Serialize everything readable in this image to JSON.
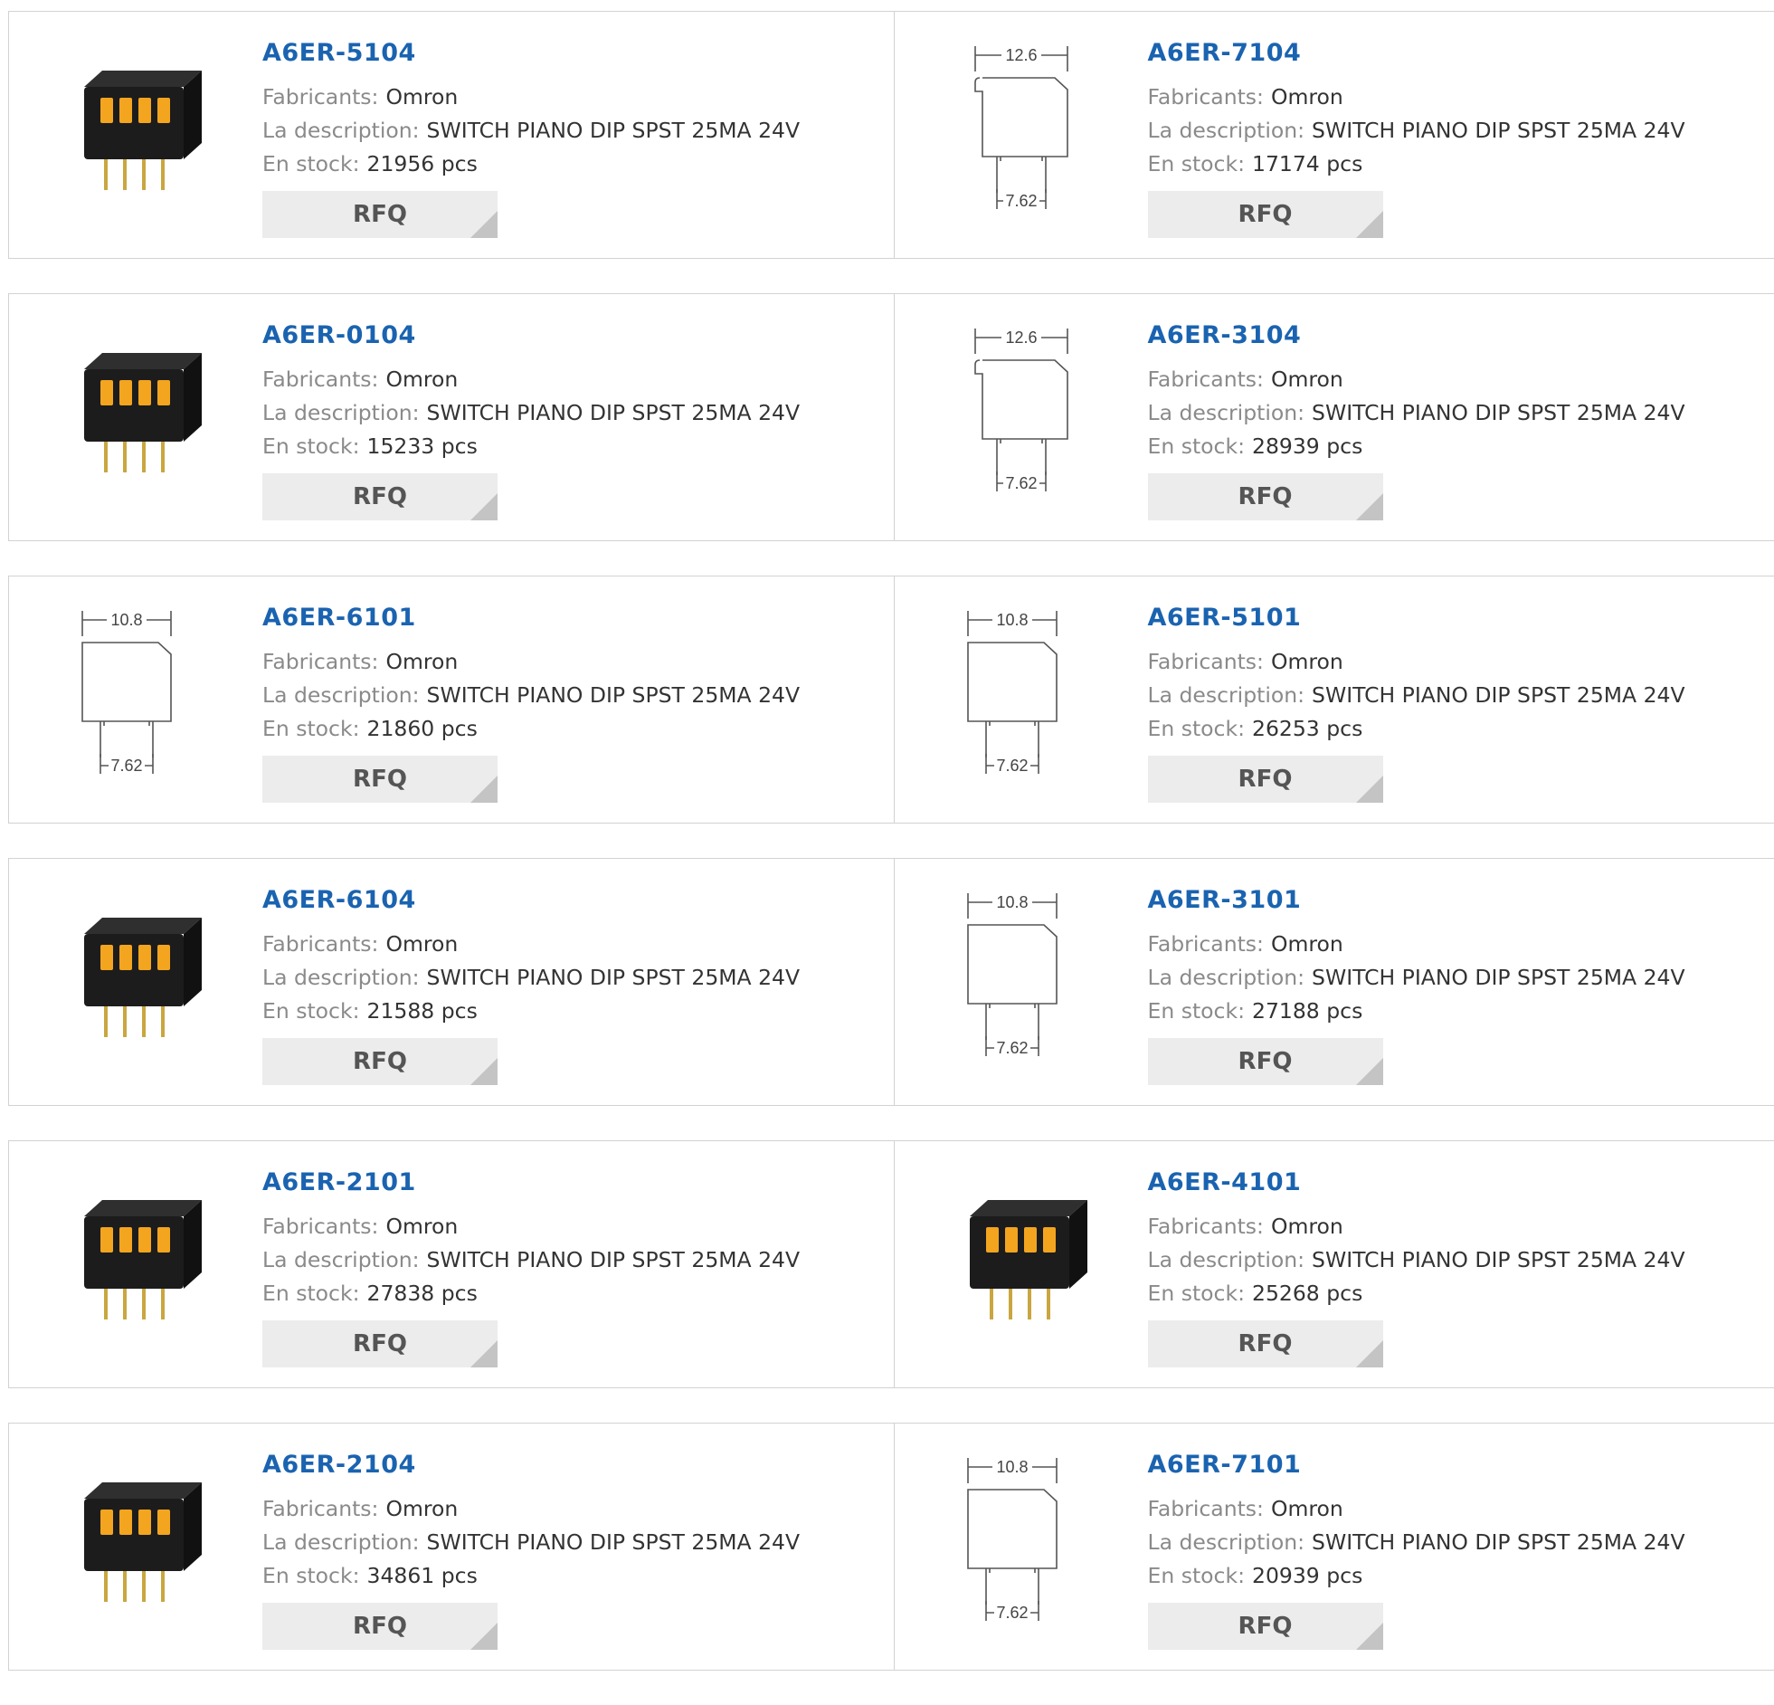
{
  "labels": {
    "manufacturer": "Fabricants:",
    "description": "La description:",
    "stock": "En stock:",
    "rfq": "RFQ"
  },
  "dimension_labels": {
    "width_12_6": "12.6",
    "width_10_8": "10.8",
    "pitch": "7.62"
  },
  "colors": {
    "title_link": "#1a63b0",
    "switch_body": "#1c1c1c",
    "actuator": "#f3a51f"
  },
  "products": [
    {
      "part": "A6ER-5104",
      "manufacturer": "Omron",
      "description": "SWITCH PIANO DIP SPST 25MA 24V",
      "stock": "21956 pcs",
      "image": "dip-switch-photo"
    },
    {
      "part": "A6ER-7104",
      "manufacturer": "Omron",
      "description": "SWITCH PIANO DIP SPST 25MA 24V",
      "stock": "17174 pcs",
      "image": "dimension-drawing-12.6"
    },
    {
      "part": "A6ER-0104",
      "manufacturer": "Omron",
      "description": "SWITCH PIANO DIP SPST 25MA 24V",
      "stock": "15233 pcs",
      "image": "dip-switch-photo"
    },
    {
      "part": "A6ER-3104",
      "manufacturer": "Omron",
      "description": "SWITCH PIANO DIP SPST 25MA 24V",
      "stock": "28939 pcs",
      "image": "dimension-drawing-12.6"
    },
    {
      "part": "A6ER-6101",
      "manufacturer": "Omron",
      "description": "SWITCH PIANO DIP SPST 25MA 24V",
      "stock": "21860 pcs",
      "image": "dimension-drawing-10.8"
    },
    {
      "part": "A6ER-5101",
      "manufacturer": "Omron",
      "description": "SWITCH PIANO DIP SPST 25MA 24V",
      "stock": "26253 pcs",
      "image": "dimension-drawing-10.8"
    },
    {
      "part": "A6ER-6104",
      "manufacturer": "Omron",
      "description": "SWITCH PIANO DIP SPST 25MA 24V",
      "stock": "21588 pcs",
      "image": "dip-switch-photo"
    },
    {
      "part": "A6ER-3101",
      "manufacturer": "Omron",
      "description": "SWITCH PIANO DIP SPST 25MA 24V",
      "stock": "27188 pcs",
      "image": "dimension-drawing-10.8"
    },
    {
      "part": "A6ER-2101",
      "manufacturer": "Omron",
      "description": "SWITCH PIANO DIP SPST 25MA 24V",
      "stock": "27838 pcs",
      "image": "dip-switch-photo"
    },
    {
      "part": "A6ER-4101",
      "manufacturer": "Omron",
      "description": "SWITCH PIANO DIP SPST 25MA 24V",
      "stock": "25268 pcs",
      "image": "dip-switch-photo"
    },
    {
      "part": "A6ER-2104",
      "manufacturer": "Omron",
      "description": "SWITCH PIANO DIP SPST 25MA 24V",
      "stock": "34861 pcs",
      "image": "dip-switch-photo"
    },
    {
      "part": "A6ER-7101",
      "manufacturer": "Omron",
      "description": "SWITCH PIANO DIP SPST 25MA 24V",
      "stock": "20939 pcs",
      "image": "dimension-drawing-10.8"
    }
  ]
}
